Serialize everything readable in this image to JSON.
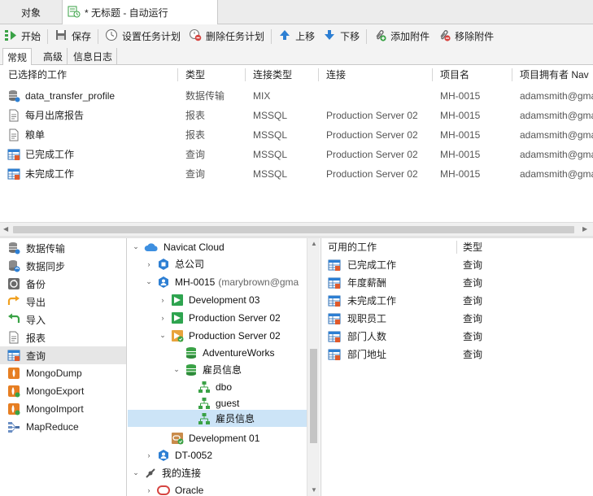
{
  "tabs": {
    "objects": "对象",
    "job": "* 无标题 - 自动运行"
  },
  "toolbar": {
    "start": "开始",
    "save": "保存",
    "set_schedule": "设置任务计划",
    "delete_schedule": "删除任务计划",
    "move_up": "上移",
    "move_down": "下移",
    "add_attachment": "添加附件",
    "remove_attachment": "移除附件"
  },
  "subtabs": [
    "常规",
    "高级",
    "信息日志"
  ],
  "job_table": {
    "columns": [
      "已选择的工作",
      "类型",
      "连接类型",
      "连接",
      "项目名",
      "项目拥有者 Nav"
    ],
    "rows": [
      {
        "name": "data_transfer_profile",
        "icon": "data-transfer-icon",
        "type": "数据传输",
        "conn_type": "MIX",
        "conn": "",
        "project": "MH-0015",
        "owner": "adamsmith@gma"
      },
      {
        "name": "每月出席报告",
        "icon": "report-icon",
        "type": "报表",
        "conn_type": "MSSQL",
        "conn": "Production Server 02",
        "project": "MH-0015",
        "owner": "adamsmith@gma"
      },
      {
        "name": "粮单",
        "icon": "report-icon",
        "type": "报表",
        "conn_type": "MSSQL",
        "conn": "Production Server 02",
        "project": "MH-0015",
        "owner": "adamsmith@gma"
      },
      {
        "name": "已完成工作",
        "icon": "query-icon",
        "type": "查询",
        "conn_type": "MSSQL",
        "conn": "Production Server 02",
        "project": "MH-0015",
        "owner": "adamsmith@gma"
      },
      {
        "name": "未完成工作",
        "icon": "query-icon",
        "type": "查询",
        "conn_type": "MSSQL",
        "conn": "Production Server 02",
        "project": "MH-0015",
        "owner": "adamsmith@gma"
      }
    ]
  },
  "categories": [
    {
      "label": "数据传输",
      "icon": "data-transfer-icon"
    },
    {
      "label": "数据同步",
      "icon": "data-sync-icon"
    },
    {
      "label": "备份",
      "icon": "backup-icon"
    },
    {
      "label": "导出",
      "icon": "export-icon"
    },
    {
      "label": "导入",
      "icon": "import-icon"
    },
    {
      "label": "报表",
      "icon": "report-icon"
    },
    {
      "label": "查询",
      "icon": "query-icon",
      "selected": true
    },
    {
      "label": "MongoDump",
      "icon": "mongodump-icon"
    },
    {
      "label": "MongoExport",
      "icon": "mongoexport-icon"
    },
    {
      "label": "MongoImport",
      "icon": "mongoimport-icon"
    },
    {
      "label": "MapReduce",
      "icon": "mapreduce-icon"
    }
  ],
  "tree": [
    {
      "label": "Navicat Cloud",
      "icon": "cloud-icon",
      "twisty": "expanded"
    },
    {
      "label": "总公司",
      "icon": "project-icon",
      "twisty": "collapsed"
    },
    {
      "label": "MH-0015",
      "suffix": "(marybrown@gma",
      "icon": "project-icon",
      "twisty": "expanded"
    },
    {
      "label": "Development 03",
      "icon": "sqlserver-icon",
      "twisty": "collapsed"
    },
    {
      "label": "Production Server 02",
      "icon": "sqlserver-icon",
      "twisty": "collapsed"
    },
    {
      "label": "Production Server 02",
      "icon": "sqlserver-connected-icon",
      "twisty": "expanded"
    },
    {
      "label": "AdventureWorks",
      "icon": "database-icon",
      "twisty": "none"
    },
    {
      "label": "雇员信息",
      "icon": "database-icon",
      "twisty": "expanded"
    },
    {
      "label": "dbo",
      "icon": "schema-icon",
      "twisty": "none"
    },
    {
      "label": "guest",
      "icon": "schema-icon",
      "twisty": "none"
    },
    {
      "label": "雇员信息",
      "icon": "schema-icon",
      "twisty": "none",
      "selected": true
    },
    {
      "label": "Development 01",
      "icon": "oracle-connected-icon",
      "twisty": "none"
    },
    {
      "label": "DT-0052",
      "icon": "project-icon",
      "twisty": "collapsed"
    },
    {
      "label": "我的连接",
      "icon": "connection-icon",
      "twisty": "expanded"
    },
    {
      "label": "Oracle",
      "icon": "oracle-icon",
      "twisty": "collapsed"
    }
  ],
  "available": {
    "columns": [
      "可用的工作",
      "类型"
    ],
    "rows": [
      {
        "name": "已完成工作",
        "type": "查询"
      },
      {
        "name": "年度薪酬",
        "type": "查询"
      },
      {
        "name": "未完成工作",
        "type": "查询"
      },
      {
        "name": "现职员工",
        "type": "查询"
      },
      {
        "name": "部门人数",
        "type": "查询"
      },
      {
        "name": "部门地址",
        "type": "查询"
      }
    ]
  },
  "colors": {
    "accent_blue": "#2d7fd3",
    "selection": "#cce4f7",
    "green": "#3aa246",
    "orange": "#e67e22",
    "red": "#d64541"
  }
}
